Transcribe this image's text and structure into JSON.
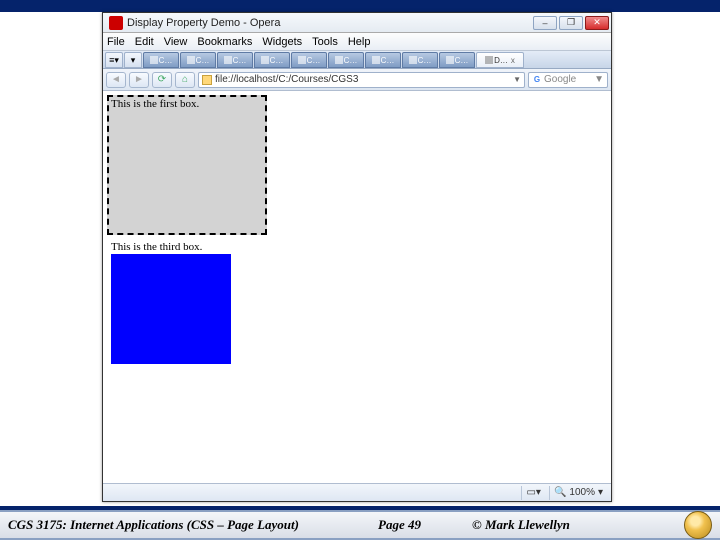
{
  "window": {
    "title": "Display Property Demo - Opera"
  },
  "menu": {
    "file": "File",
    "edit": "Edit",
    "view": "View",
    "bookmarks": "Bookmarks",
    "widgets": "Widgets",
    "tools": "Tools",
    "help": "Help"
  },
  "tabs": {
    "generic_label": "C…",
    "active_label": "D…",
    "close_x": "x"
  },
  "address": {
    "url": "file://localhost/C:/Courses/CGS3",
    "search_placeholder": "Google",
    "search_prefix": "G"
  },
  "demo": {
    "box1_text": "This is the first box.",
    "box3_text": "This is the third box."
  },
  "status": {
    "zoom": "100%"
  },
  "slide": {
    "course": "CGS 3175: Internet Applications (CSS – Page Layout)",
    "page": "Page 49",
    "author": "© Mark Llewellyn"
  }
}
